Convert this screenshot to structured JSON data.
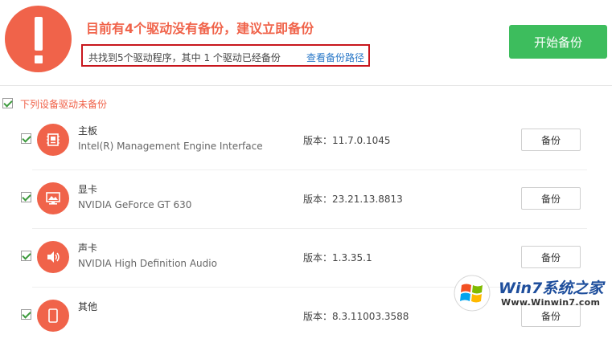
{
  "header": {
    "headline": "目前有4个驱动没有备份，建议立即备份",
    "summary": "共找到5个驱动程序，其中 1 个驱动已经备份",
    "summary_link": "查看备份路径",
    "start_button": "开始备份",
    "alert_icon": "exclamation-icon"
  },
  "section": {
    "title": "下列设备驱动未备份",
    "checked": true
  },
  "drivers": [
    {
      "name": "主板",
      "desc": "Intel(R) Management Engine Interface",
      "version": "版本：11.7.0.1045",
      "button": "备份",
      "icon": "motherboard-icon",
      "checked": true
    },
    {
      "name": "显卡",
      "desc": "NVIDIA GeForce GT 630",
      "version": "版本：23.21.13.8813",
      "button": "备份",
      "icon": "monitor-icon",
      "checked": true
    },
    {
      "name": "声卡",
      "desc": "NVIDIA High Definition Audio",
      "version": "版本：1.3.35.1",
      "button": "备份",
      "icon": "speaker-icon",
      "checked": true
    },
    {
      "name": "其他",
      "desc": "",
      "version": "版本：8.3.11003.3588",
      "button": "备份",
      "icon": "device-icon",
      "checked": true
    }
  ],
  "watermark": {
    "brand": "Win7系统之家",
    "url": "Www.Winwin7.com"
  },
  "colors": {
    "accent": "#f0634a",
    "primary_button": "#3dbd5d",
    "highlight_border": "#c8161d",
    "link": "#2a78c8"
  }
}
